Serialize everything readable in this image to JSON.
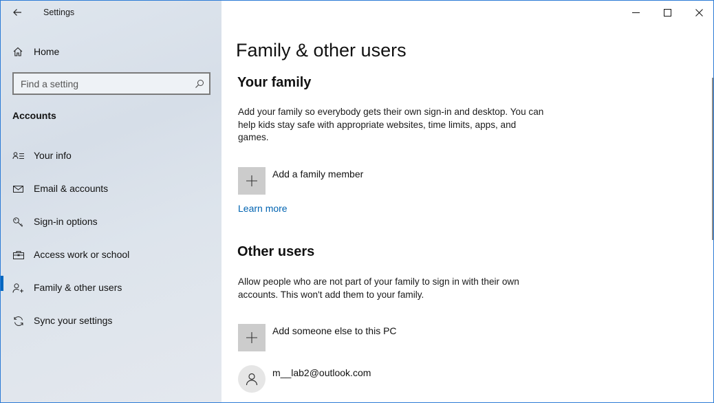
{
  "app": {
    "title": "Settings"
  },
  "sidebar": {
    "home_label": "Home",
    "search": {
      "placeholder": "Find a setting"
    },
    "section_title": "Accounts",
    "items": [
      {
        "label": "Your info",
        "icon": "contact-card-icon",
        "active": false
      },
      {
        "label": "Email & accounts",
        "icon": "mail-icon",
        "active": false
      },
      {
        "label": "Sign-in options",
        "icon": "key-icon",
        "active": false
      },
      {
        "label": "Access work or school",
        "icon": "briefcase-icon",
        "active": false
      },
      {
        "label": "Family & other users",
        "icon": "add-person-icon",
        "active": true
      },
      {
        "label": "Sync your settings",
        "icon": "sync-icon",
        "active": false
      }
    ]
  },
  "main": {
    "title": "Family & other users",
    "family": {
      "heading": "Your family",
      "description": "Add your family so everybody gets their own sign-in and desktop. You can help kids stay safe with appropriate websites, time limits, apps, and games.",
      "add_label": "Add a family member",
      "learn_more": "Learn more"
    },
    "other": {
      "heading": "Other users",
      "description": "Allow people who are not part of your family to sign in with their own accounts. This won't add them to your family.",
      "add_label": "Add someone else to this PC",
      "users": [
        {
          "email": "m__lab2@outlook.com"
        }
      ]
    }
  },
  "colors": {
    "accent": "#0067c0",
    "link": "#0063b1",
    "sidebar_bg": "#dde4ec",
    "tile_bg": "#cccccc"
  }
}
